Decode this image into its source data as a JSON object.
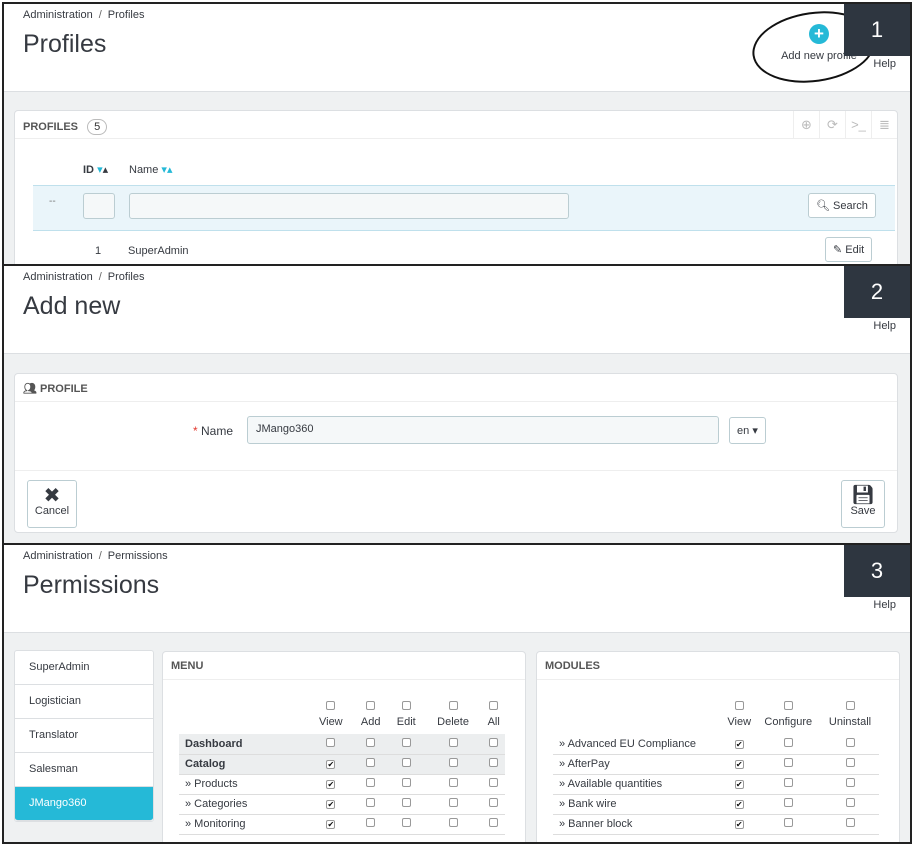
{
  "panel1": {
    "breadcrumb": [
      "Administration",
      "Profiles"
    ],
    "title": "Profiles",
    "step": "1",
    "add_profile_label": "Add new profile",
    "help_label": "Help",
    "list_title": "PROFILES",
    "count": "5",
    "columns": [
      "ID",
      "Name"
    ],
    "filter_dash": "--",
    "search_label": "Search",
    "row": {
      "id": "1",
      "name": "SuperAdmin"
    },
    "edit_label": "Edit"
  },
  "panel2": {
    "breadcrumb": [
      "Administration",
      "Profiles"
    ],
    "title": "Add new",
    "step": "2",
    "help_label": "Help",
    "section_title": "PROFILE",
    "name_label": "Name",
    "name_value": "JMango360",
    "lang": "en",
    "cancel_label": "Cancel",
    "save_label": "Save"
  },
  "panel3": {
    "breadcrumb": [
      "Administration",
      "Permissions"
    ],
    "title": "Permissions",
    "step": "3",
    "help_label": "Help",
    "profiles": [
      "SuperAdmin",
      "Logistician",
      "Translator",
      "Salesman",
      "JMango360"
    ],
    "menu": {
      "title": "MENU",
      "columns": [
        "View",
        "Add",
        "Edit",
        "Delete",
        "All"
      ],
      "rows": [
        {
          "label": "Dashboard",
          "bold": true,
          "checks": [
            false,
            false,
            false,
            false,
            false
          ]
        },
        {
          "label": "Catalog",
          "bold": true,
          "checks": [
            true,
            false,
            false,
            false,
            false
          ]
        },
        {
          "label": "» Products",
          "bold": false,
          "checks": [
            true,
            false,
            false,
            false,
            false
          ]
        },
        {
          "label": "» Categories",
          "bold": false,
          "checks": [
            true,
            false,
            false,
            false,
            false
          ]
        },
        {
          "label": "» Monitoring",
          "bold": false,
          "checks": [
            true,
            false,
            false,
            false,
            false
          ]
        }
      ]
    },
    "modules": {
      "title": "MODULES",
      "columns": [
        "View",
        "Configure",
        "Uninstall"
      ],
      "rows": [
        {
          "label": "» Advanced EU Compliance",
          "checks": [
            true,
            false,
            false
          ]
        },
        {
          "label": "» AfterPay",
          "checks": [
            true,
            false,
            false
          ]
        },
        {
          "label": "» Available quantities",
          "checks": [
            true,
            false,
            false
          ]
        },
        {
          "label": "» Bank wire",
          "checks": [
            true,
            false,
            false
          ]
        },
        {
          "label": "» Banner block",
          "checks": [
            true,
            false,
            false
          ]
        }
      ]
    }
  },
  "colors": {
    "accent": "#25b9d7",
    "dark_badge": "#2e3640"
  }
}
